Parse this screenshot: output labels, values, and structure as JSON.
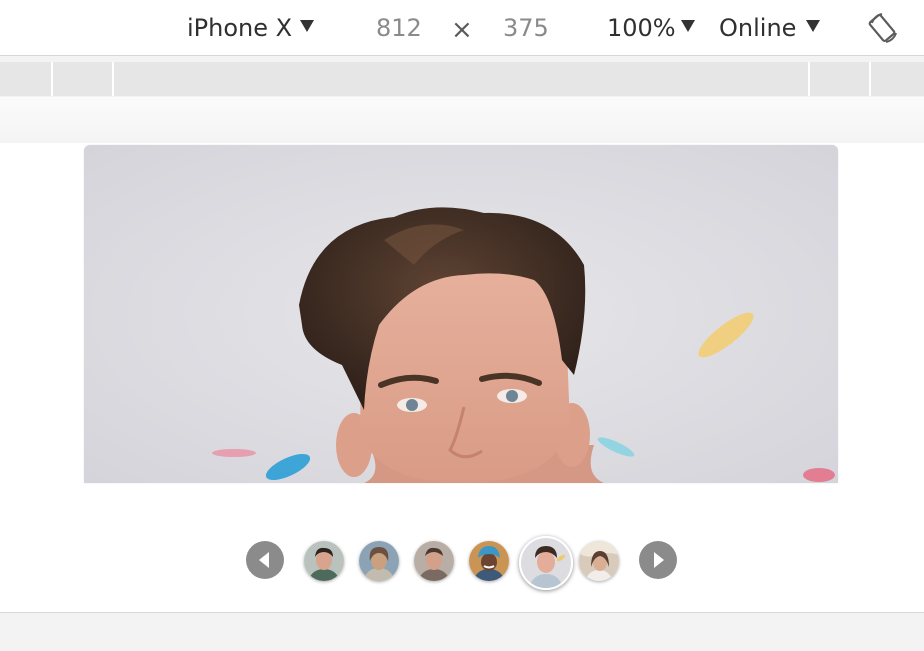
{
  "toolbar": {
    "device": "iPhone X",
    "width": "812",
    "times": "×",
    "height": "375",
    "zoom": "100%",
    "network": "Online",
    "rotate_icon": "rotate-device-icon"
  },
  "carousel": {
    "prev_icon": "chevron-left-icon",
    "next_icon": "chevron-right-icon",
    "thumbnail_count": 6,
    "active_index": 4
  },
  "colors": {
    "nav_button": "#8b8b8b",
    "ruler": "#e6e6e6",
    "photo_background": "#dedee3"
  }
}
